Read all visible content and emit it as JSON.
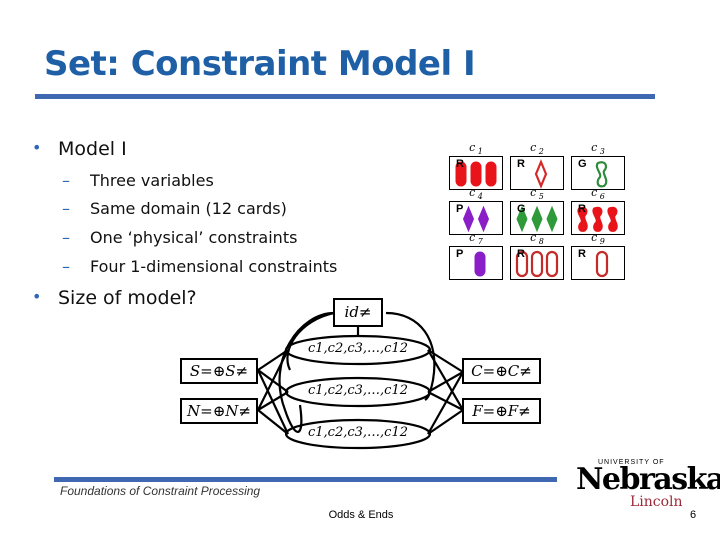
{
  "slide": {
    "title": "Set: Constraint Model I",
    "bullets": [
      {
        "text": "Model I",
        "subs": [
          "Three variables",
          "Same domain (12 cards)",
          "One ‘physical’ constraints",
          "Four 1-dimensional constraints"
        ]
      },
      {
        "text": "Size of model?",
        "subs": []
      }
    ],
    "bullet_glyph": "•",
    "dash_glyph": "–"
  },
  "cards": [
    {
      "name": "c1",
      "sub": "1",
      "letter": "R",
      "color": "#e8141a",
      "shape": "oval",
      "fill": "solid",
      "count": 3
    },
    {
      "name": "c2",
      "sub": "2",
      "letter": "R",
      "color": "#d42a2a",
      "shape": "diamond",
      "fill": "empty",
      "count": 1
    },
    {
      "name": "c3",
      "sub": "3",
      "letter": "G",
      "color": "#2e8b3a",
      "shape": "squiggle",
      "fill": "empty",
      "count": 1
    },
    {
      "name": "c4",
      "sub": "4",
      "letter": "P",
      "color": "#8a1fc8",
      "shape": "diamond",
      "fill": "solid",
      "count": 2
    },
    {
      "name": "c5",
      "sub": "5",
      "letter": "G",
      "color": "#2f9a3a",
      "shape": "diamond",
      "fill": "solid",
      "count": 3
    },
    {
      "name": "c6",
      "sub": "6",
      "letter": "R",
      "color": "#e8141a",
      "shape": "squiggle",
      "fill": "solid",
      "count": 3
    },
    {
      "name": "c7",
      "sub": "7",
      "letter": "P",
      "color": "#8a1fc8",
      "shape": "oval",
      "fill": "solid",
      "count": 1
    },
    {
      "name": "c8",
      "sub": "8",
      "letter": "R",
      "color": "#c42a2a",
      "shape": "oval",
      "fill": "empty",
      "count": 3
    },
    {
      "name": "c9",
      "sub": "9",
      "letter": "R",
      "color": "#c42a2a",
      "shape": "oval",
      "fill": "empty",
      "count": 1
    }
  ],
  "card_label_prefix": "c",
  "graph": {
    "id_node": "id≠",
    "variable_label": "c1,c2,c3,…,c12",
    "variables": [
      "c1,c2,c3,…,c12",
      "c1,c2,c3,…,c12",
      "c1,c2,c3,…,c12"
    ],
    "left_nodes": [
      "S=⊕S≠",
      "N=⊕N≠"
    ],
    "right_nodes": [
      "C=⊕C≠",
      "F=⊕F≠"
    ]
  },
  "footer": {
    "course": "Foundations of Constraint Processing",
    "section": "Odds & Ends",
    "page": "6",
    "logo_university": "UNIVERSITY OF",
    "logo_name": "Nebraska",
    "logo_campus": "Lincoln"
  }
}
